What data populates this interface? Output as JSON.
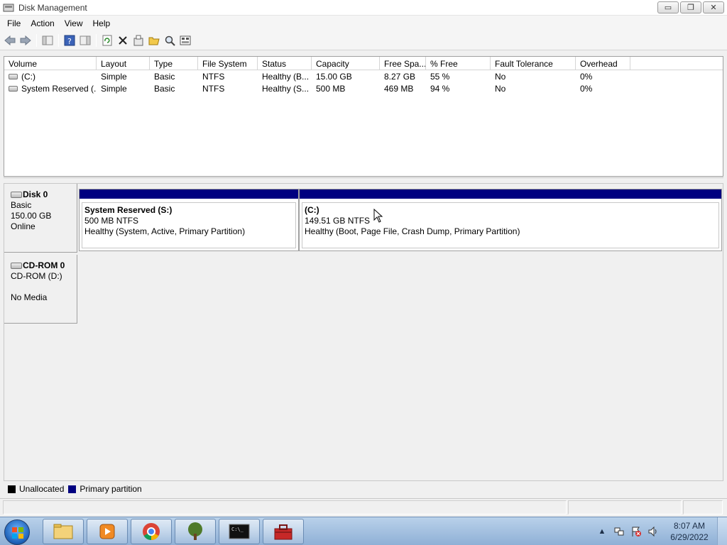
{
  "window": {
    "title": "Disk Management",
    "minimize_glyph": "▭",
    "restore_glyph": "❐",
    "close_glyph": "✕"
  },
  "menu": [
    "File",
    "Action",
    "View",
    "Help"
  ],
  "toolbar": {
    "icons": [
      "back-icon",
      "forward-icon",
      "console-tree-icon",
      "help-icon",
      "properties-pane-icon",
      "refresh-icon",
      "delete-icon",
      "properties-icon",
      "open-icon",
      "explore-icon",
      "rescan-icon"
    ]
  },
  "volume_table": {
    "columns": [
      "Volume",
      "Layout",
      "Type",
      "File System",
      "Status",
      "Capacity",
      "Free Spa...",
      "% Free",
      "Fault Tolerance",
      "Overhead"
    ],
    "rows": [
      [
        "(C:)",
        "Simple",
        "Basic",
        "NTFS",
        "Healthy (B...",
        "15.00 GB",
        "8.27 GB",
        "55 %",
        "No",
        "0%"
      ],
      [
        "System Reserved (...",
        "Simple",
        "Basic",
        "NTFS",
        "Healthy (S...",
        "500 MB",
        "469 MB",
        "94 %",
        "No",
        "0%"
      ]
    ]
  },
  "disks": [
    {
      "name": "Disk 0",
      "type": "Basic",
      "size": "150.00 GB",
      "state": "Online",
      "partitions": [
        {
          "name": "System Reserved  (S:)",
          "size": "500 MB NTFS",
          "status": "Healthy (System, Active, Primary Partition)"
        },
        {
          "name": " (C:)",
          "size": "149.51 GB NTFS",
          "status": "Healthy (Boot, Page File, Crash Dump, Primary Partition)"
        }
      ]
    },
    {
      "name": "CD-ROM 0",
      "type": "CD-ROM (D:)",
      "size": "",
      "state": "No Media"
    }
  ],
  "legend": [
    {
      "label": "Unallocated",
      "color": "#000000"
    },
    {
      "label": "Primary partition",
      "color": "#000080"
    }
  ],
  "taskbar": {
    "apps": [
      "explorer-icon",
      "media-player-icon",
      "chrome-icon",
      "tree-app-icon",
      "command-prompt-icon",
      "toolbox-icon"
    ],
    "cmd_glyph": "C:\\_",
    "tray_arrow": "▲",
    "clock_time": "8:07 AM",
    "clock_date": "6/29/2022"
  },
  "colors": {
    "primary_partition": "#000080",
    "unallocated": "#000000"
  }
}
